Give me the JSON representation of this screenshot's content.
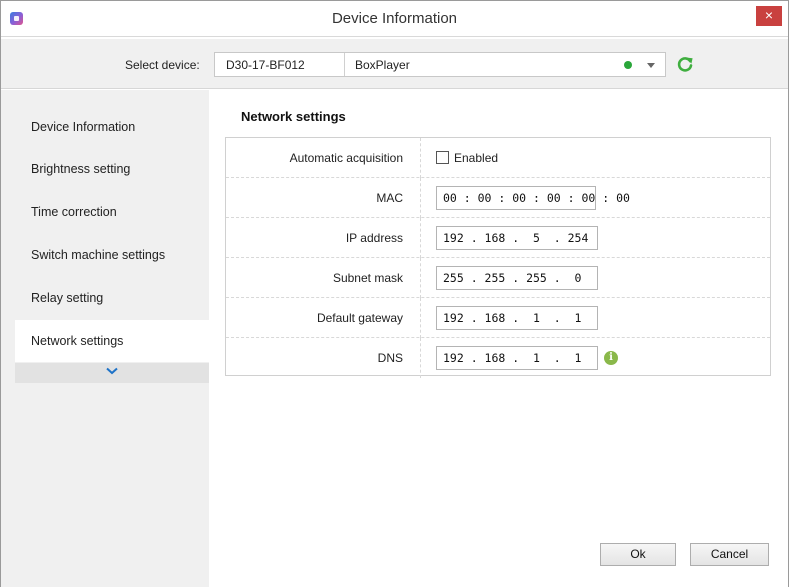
{
  "window": {
    "title": "Device Information",
    "close_glyph": "×"
  },
  "device_bar": {
    "label": "Select device:",
    "device_id": "D30-17-BF012",
    "device_name": "BoxPlayer",
    "status_color": "#2aa63a"
  },
  "sidebar": {
    "items": [
      {
        "label": "Device Information"
      },
      {
        "label": "Brightness setting"
      },
      {
        "label": "Time correction"
      },
      {
        "label": "Switch machine settings"
      },
      {
        "label": "Relay setting"
      },
      {
        "label": "Network settings",
        "active": true
      }
    ]
  },
  "main": {
    "section_title": "Network settings",
    "rows": {
      "auto": {
        "label": "Automatic acquisition",
        "checkbox_label": "Enabled",
        "checked": false
      },
      "mac": {
        "label": "MAC",
        "value": "00 : 00 : 00 : 00 : 00 : 00"
      },
      "ip": {
        "label": "IP address",
        "value": "192 . 168 .  5  . 254"
      },
      "subnet": {
        "label": "Subnet mask",
        "value": "255 . 255 . 255 .  0"
      },
      "gateway": {
        "label": "Default gateway",
        "value": "192 . 168 .  1  .  1"
      },
      "dns": {
        "label": "DNS",
        "value": "192 . 168 .  1  .  1",
        "info_glyph": "i"
      }
    },
    "buttons": {
      "ok": "Ok",
      "cancel": "Cancel"
    }
  },
  "icons": {
    "app": "app-icon",
    "close": "close-icon",
    "refresh": "refresh-icon",
    "dropdown": "chevron-down-icon",
    "info": "info-icon",
    "more": "chevron-down-icon"
  },
  "colors": {
    "accent": "#1e73c8",
    "close_button": "#c9413f",
    "refresh_green": "#3fae3f",
    "info_green": "#8ab84a"
  }
}
